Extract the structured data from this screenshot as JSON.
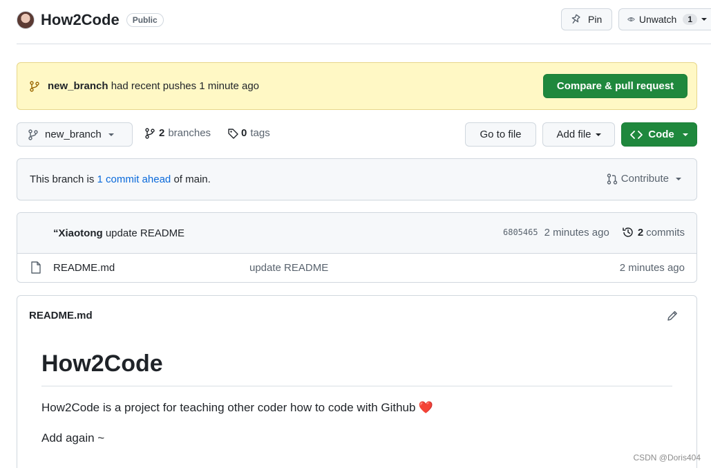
{
  "repo": {
    "name": "How2Code",
    "visibility": "Public",
    "pin_label": "Pin",
    "unwatch_label": "Unwatch",
    "watch_count": "1"
  },
  "banner": {
    "branch": "new_branch",
    "text": "had recent pushes 1 minute ago",
    "compare_label": "Compare & pull request"
  },
  "toolbar": {
    "branch_label": "new_branch",
    "branches_count": "2",
    "branches_label": "branches",
    "tags_count": "0",
    "tags_label": "tags",
    "goto_label": "Go to file",
    "addfile_label": "Add file",
    "code_label": "Code"
  },
  "ahead": {
    "prefix": "This branch is",
    "link": "1 commit ahead",
    "suffix": "of main.",
    "contribute_label": "Contribute"
  },
  "latest_commit": {
    "author": "“Xiaotong",
    "message": "update README",
    "sha": "6805465",
    "time": "2 minutes ago",
    "commits_count": "2",
    "commits_label": "commits"
  },
  "files": [
    {
      "name": "README.md",
      "message": "update README",
      "time": "2 minutes ago"
    }
  ],
  "readme": {
    "title": "README.md",
    "heading": "How2Code",
    "paragraph1": "How2Code is a project for teaching other coder how to code with Github",
    "heart": "❤️",
    "paragraph2": "Add again ~"
  },
  "watermark": "CSDN @Doris404",
  "colors": {
    "accent_green": "#1f883d",
    "link_blue": "#0969da",
    "banner_yellow": "#fff8c5"
  }
}
